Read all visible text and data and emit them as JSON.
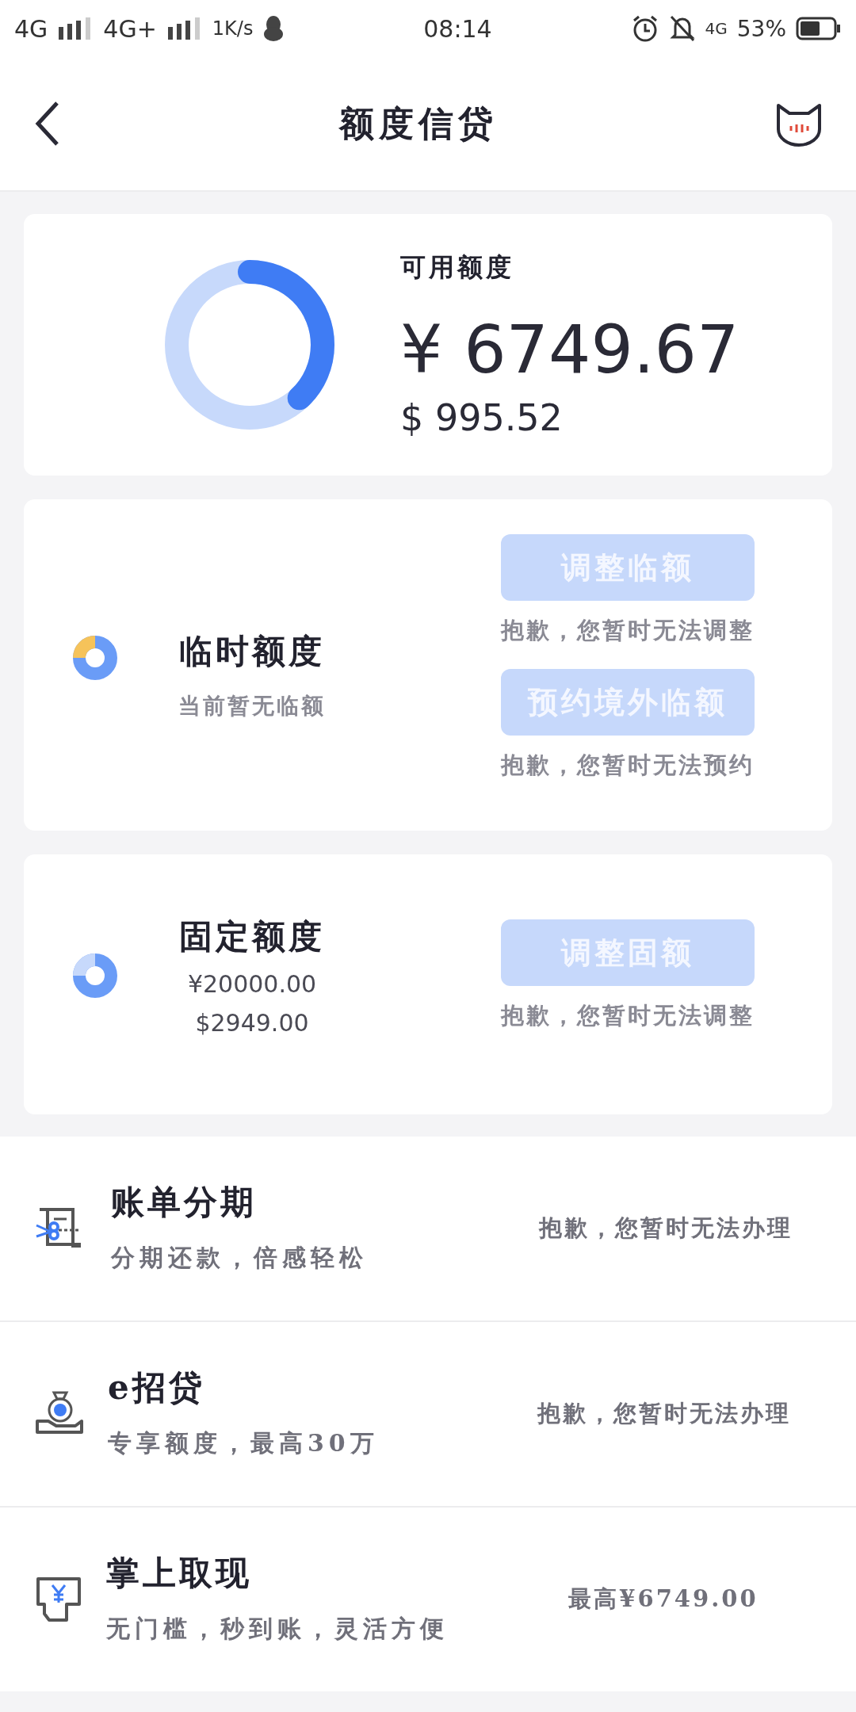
{
  "status_bar": {
    "network_1": "4G",
    "network_2": "4G+",
    "speed": "1K/s",
    "time": "08:14",
    "network_3": "4G",
    "battery": "53%"
  },
  "header": {
    "title": "额度信贷"
  },
  "available": {
    "label": "可用额度",
    "amount_cny": "¥ 6749.67",
    "amount_usd": "$ 995.52"
  },
  "temporary": {
    "title": "临时额度",
    "subtitle": "当前暂无临额",
    "actions": [
      {
        "label": "调整临额",
        "disabled": true,
        "note": "抱歉，您暂时无法调整"
      },
      {
        "label": "预约境外临额",
        "disabled": true,
        "note": "抱歉，您暂时无法预约"
      }
    ]
  },
  "fixed": {
    "title": "固定额度",
    "amount_cny": "¥20000.00",
    "amount_usd": "$2949.00",
    "actions": [
      {
        "label": "调整固额",
        "disabled": true,
        "note": "抱歉，您暂时无法调整"
      }
    ]
  },
  "services": [
    {
      "kind": "bill",
      "title": "账单分期",
      "subtitle": "分期还款，倍感轻松",
      "status": "抱歉，您暂时无法办理"
    },
    {
      "kind": "loan",
      "title": "e招贷",
      "subtitle": "专享额度，最高30万",
      "status": "抱歉，您暂时无法办理"
    },
    {
      "kind": "cash",
      "title": "掌上取现",
      "subtitle": "无门槛，秒到账，灵活方便",
      "status": "最高¥6749.00"
    }
  ]
}
